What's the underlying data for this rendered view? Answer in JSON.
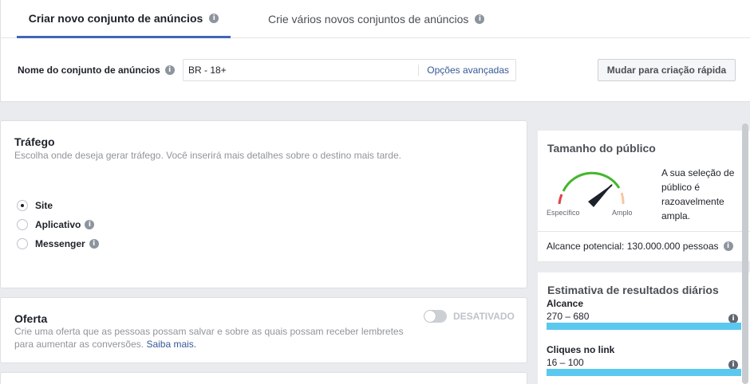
{
  "tabs": [
    {
      "label": "Criar novo conjunto de anúncios",
      "active": true
    },
    {
      "label": "Crie vários novos conjuntos de anúncios",
      "active": false
    }
  ],
  "adset": {
    "name_label": "Nome do conjunto de anúncios",
    "name_value": "BR - 18+",
    "advanced_link": "Opções avançadas",
    "quick_button": "Mudar para criação rápida"
  },
  "traffic": {
    "title": "Tráfego",
    "subtitle": "Escolha onde deseja gerar tráfego. Você inserirá mais detalhes sobre o destino mais tarde.",
    "options": [
      {
        "label": "Site",
        "selected": true
      },
      {
        "label": "Aplicativo",
        "selected": false
      },
      {
        "label": "Messenger",
        "selected": false
      }
    ]
  },
  "offer": {
    "title": "Oferta",
    "toggle_label": "DESATIVADO",
    "description": "Crie uma oferta que as pessoas possam salvar e sobre as quais possam receber lembretes para aumentar as conversões.",
    "learn_more": "Saiba mais."
  },
  "audience": {
    "title": "Tamanho do público",
    "gauge_left": "Específico",
    "gauge_right": "Amplo",
    "description": "A sua seleção de público é razoavelmente ampla.",
    "potential_reach": "Alcance potencial: 130.000.000 pessoas"
  },
  "estimates": {
    "title": "Estimativa de resultados diários",
    "metrics": [
      {
        "label": "Alcance",
        "value": "270 – 680"
      },
      {
        "label": "Cliques no link",
        "value": "16 – 100"
      }
    ]
  },
  "colors": {
    "accent": "#4267b2",
    "link": "#365899",
    "bar": "#5bc8f0",
    "gauge_green": "#42b72a",
    "gauge_red": "#e0434a",
    "gauge_orange": "#f6c7a4"
  }
}
